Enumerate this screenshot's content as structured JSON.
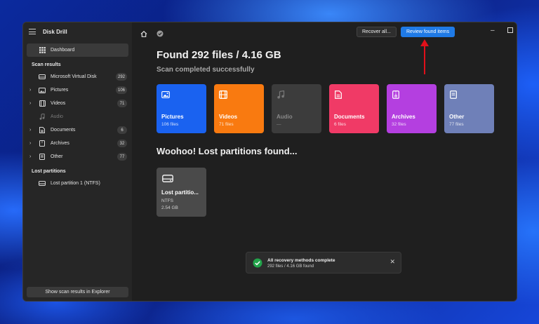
{
  "app": {
    "title": "Disk Drill"
  },
  "sidebar": {
    "dashboard": "Dashboard",
    "scan_results_label": "Scan results",
    "items": [
      {
        "label": "Microsoft Virtual Disk",
        "count": "292"
      },
      {
        "label": "Pictures",
        "count": "106"
      },
      {
        "label": "Videos",
        "count": "71"
      },
      {
        "label": "Audio",
        "count": ""
      },
      {
        "label": "Documents",
        "count": "6"
      },
      {
        "label": "Archives",
        "count": "32"
      },
      {
        "label": "Other",
        "count": "77"
      }
    ],
    "lost_partitions_label": "Lost partitions",
    "lost_partition_item": "Lost partition 1 (NTFS)",
    "footer_button": "Show scan results in Explorer"
  },
  "toolbar": {
    "recover_all": "Recover all...",
    "review_found": "Review found items"
  },
  "main": {
    "headline": "Found 292 files / 4.16 GB",
    "subline": "Scan completed successfully",
    "cards": [
      {
        "name": "Pictures",
        "count": "106 files",
        "color": "#1a62f0",
        "icon": "image-icon"
      },
      {
        "name": "Videos",
        "count": "71 files",
        "color": "#f97a10",
        "icon": "film-icon"
      },
      {
        "name": "Audio",
        "count": "—",
        "color": "#3c3c3c",
        "icon": "music-note-icon"
      },
      {
        "name": "Documents",
        "count": "6 files",
        "color": "#f03a66",
        "icon": "document-icon"
      },
      {
        "name": "Archives",
        "count": "32 files",
        "color": "#b43fe0",
        "icon": "archive-icon"
      },
      {
        "name": "Other",
        "count": "77 files",
        "color": "#6f80b8",
        "icon": "file-icon"
      }
    ],
    "partitions_heading": "Woohoo! Lost partitions found...",
    "partition": {
      "name": "Lost partitio...",
      "fs": "NTFS",
      "size": "2.54 GB"
    }
  },
  "toast": {
    "title": "All recovery methods complete",
    "detail": "292 files / 4.16 GB found"
  },
  "colors": {
    "accent": "#1f7ae6",
    "annotation_arrow": "#e0101a"
  }
}
